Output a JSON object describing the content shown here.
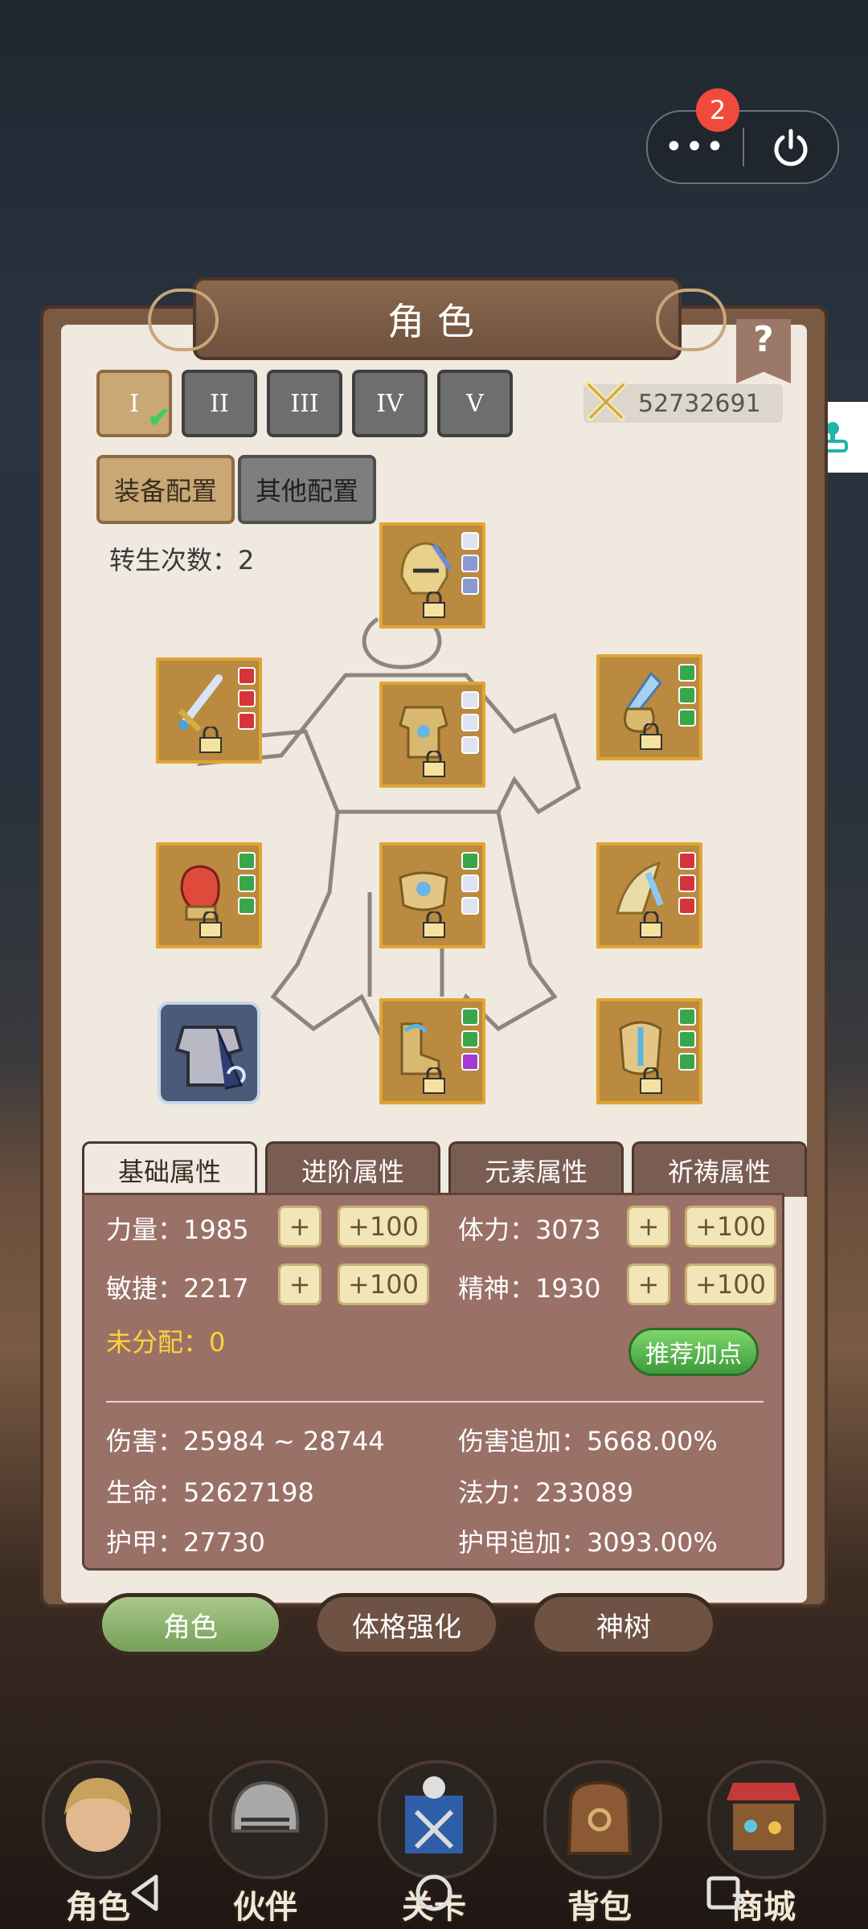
{
  "notifications": {
    "count": "2"
  },
  "capsule": {
    "more_label": "•••"
  },
  "panel": {
    "title": "角色",
    "help_label": "?",
    "loadouts": [
      {
        "label": "I",
        "active": true
      },
      {
        "label": "II",
        "active": false
      },
      {
        "label": "III",
        "active": false
      },
      {
        "label": "IV",
        "active": false
      },
      {
        "label": "V",
        "active": false
      }
    ],
    "combat_power": "52732691",
    "equip_config_label": "装备配置",
    "other_config_label": "其他配置",
    "rebirth_text": "转生次数：2"
  },
  "attributes": {
    "tabs": [
      "基础属性",
      "进阶属性",
      "元素属性",
      "祈祷属性"
    ],
    "plus_label": "+",
    "plus100_label": "+100",
    "strength": "力量：1985",
    "stamina": "体力：3073",
    "agility": "敏捷：2217",
    "spirit": "精神：1930",
    "unassigned": "未分配：0",
    "recommend_label": "推荐加点",
    "damage": "伤害：25984 ~ 28744",
    "damage_bonus": "伤害追加：5668.00%",
    "life": "生命：52627198",
    "mana": "法力：233089",
    "armor": "护甲：27730",
    "armor_bonus": "护甲追加：3093.00%"
  },
  "panel_tabs": [
    "角色",
    "体格强化",
    "神树"
  ],
  "bottom_nav": [
    "角色",
    "伙伴",
    "关卡",
    "背包",
    "商城"
  ],
  "colors": {
    "gold": "#e0a534",
    "accent_green": "#3bd15a",
    "unassigned_yellow": "#ffd23a"
  }
}
